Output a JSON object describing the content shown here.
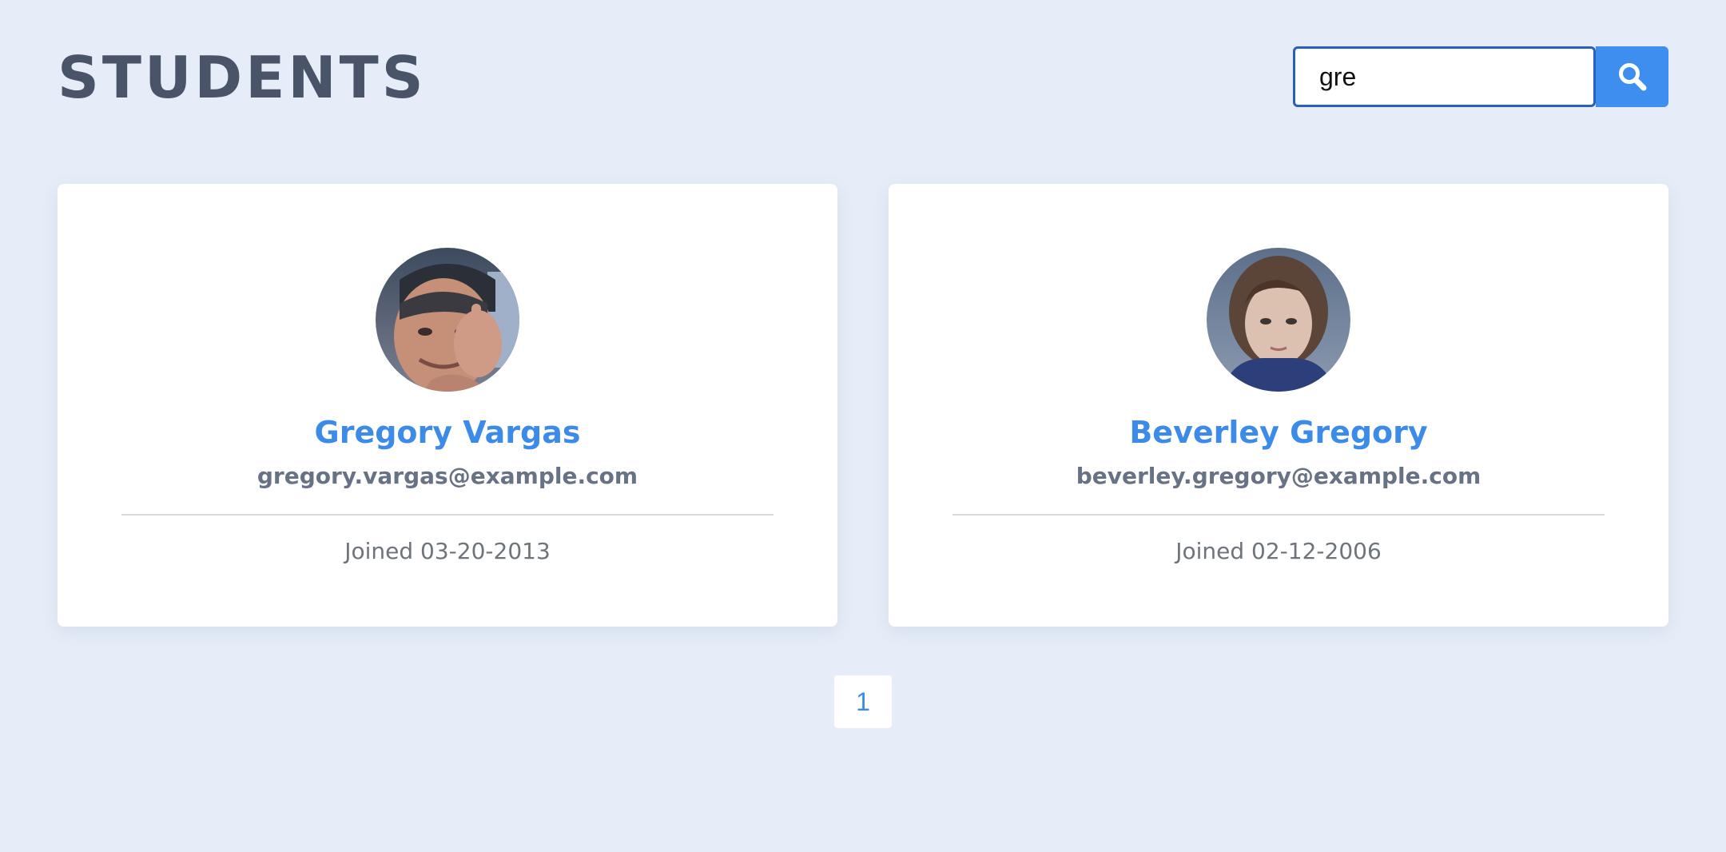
{
  "header": {
    "title": "STUDENTS"
  },
  "search": {
    "value": "gre",
    "button_icon": "search-icon",
    "button_color": "#3e8ef0",
    "border_color": "#2a5fbd"
  },
  "students": [
    {
      "name": "Gregory Vargas",
      "email": "gregory.vargas@example.com",
      "joined": "Joined 03-20-2013",
      "avatar": "avatar-photo"
    },
    {
      "name": "Beverley Gregory",
      "email": "beverley.gregory@example.com",
      "joined": "Joined 02-12-2006",
      "avatar": "avatar-photo"
    }
  ],
  "pagination": {
    "pages": [
      "1"
    ],
    "current": "1"
  },
  "colors": {
    "background": "#e6edf8",
    "accent": "#3d8be8",
    "title": "#4a5468"
  }
}
